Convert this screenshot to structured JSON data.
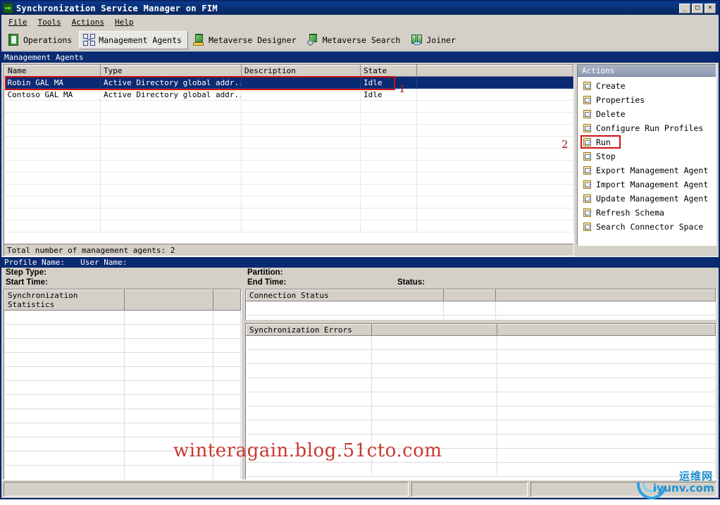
{
  "window": {
    "title": "Synchronization Service Manager on FIM",
    "icon": "sync-service-icon",
    "controls": {
      "minimize": "_",
      "maximize": "□",
      "close": "×"
    }
  },
  "menu": {
    "items": [
      {
        "label": "File",
        "accel": "F"
      },
      {
        "label": "Tools",
        "accel": "T"
      },
      {
        "label": "Actions",
        "accel": "A"
      },
      {
        "label": "Help",
        "accel": "H"
      }
    ]
  },
  "toolbar": {
    "tabs": [
      {
        "label": "Operations",
        "icon": "operations-icon",
        "active": false
      },
      {
        "label": "Management Agents",
        "icon": "management-agents-icon",
        "active": true
      },
      {
        "label": "Metaverse Designer",
        "icon": "metaverse-designer-icon",
        "active": false
      },
      {
        "label": "Metaverse Search",
        "icon": "metaverse-search-icon",
        "active": false
      },
      {
        "label": "Joiner",
        "icon": "joiner-icon",
        "active": false
      }
    ]
  },
  "section_band": {
    "title": "Management Agents"
  },
  "agents_table": {
    "columns": [
      "Name",
      "Type",
      "Description",
      "State"
    ],
    "rows": [
      {
        "name": "Robin GAL MA",
        "type": "Active Directory global addr...",
        "description": "",
        "state": "Idle",
        "selected": true
      },
      {
        "name": "Contoso GAL MA",
        "type": "Active Directory global addr...",
        "description": "",
        "state": "Idle",
        "selected": false
      }
    ],
    "empty_row_count": 10,
    "total_text": "Total number of management agents: 2"
  },
  "actions_pane": {
    "header": "Actions",
    "items": [
      {
        "label": "Create",
        "icon": "clipboard-check-icon"
      },
      {
        "label": "Properties",
        "icon": "clipboard-check-icon"
      },
      {
        "label": "Delete",
        "icon": "clipboard-check-icon"
      },
      {
        "label": "Configure Run Profiles",
        "icon": "clipboard-check-icon"
      },
      {
        "label": "Run",
        "icon": "clipboard-check-icon",
        "highlighted": true
      },
      {
        "label": "Stop",
        "icon": "clipboard-check-icon"
      },
      {
        "label": "Export Management Agent",
        "icon": "clipboard-check-icon"
      },
      {
        "label": "Import Management Agent",
        "icon": "clipboard-check-icon"
      },
      {
        "label": "Update Management Agent",
        "icon": "clipboard-check-icon"
      },
      {
        "label": "Refresh Schema",
        "icon": "clipboard-check-icon"
      },
      {
        "label": "Search Connector Space",
        "icon": "clipboard-check-icon"
      }
    ]
  },
  "annotations": {
    "marker_1": "1",
    "marker_2": "2",
    "highlight_color": "#cc1111",
    "marker_color": "#a22020"
  },
  "run_detail": {
    "profile_band": {
      "profile_name_label": "Profile Name:",
      "user_name_label": "User Name:"
    },
    "fields": {
      "step_type": "Step Type:",
      "start_time": "Start Time:",
      "partition": "Partition:",
      "end_time": "End Time:",
      "status": "Status:"
    }
  },
  "sync_statistics": {
    "header": "Synchronization Statistics",
    "row_count": 12
  },
  "connection_status": {
    "header": "Connection Status",
    "row_count": 2
  },
  "sync_errors": {
    "header": "Synchronization Errors",
    "row_count": 10
  },
  "statusbar": {
    "panels": [
      "",
      "",
      ""
    ]
  },
  "watermark": {
    "text": "winteragain.blog.51cto.com",
    "color": "#c8392f"
  },
  "logo": {
    "cn_text": "运维网",
    "en_text": "iyunv.com",
    "color": "#1d8fd1"
  }
}
